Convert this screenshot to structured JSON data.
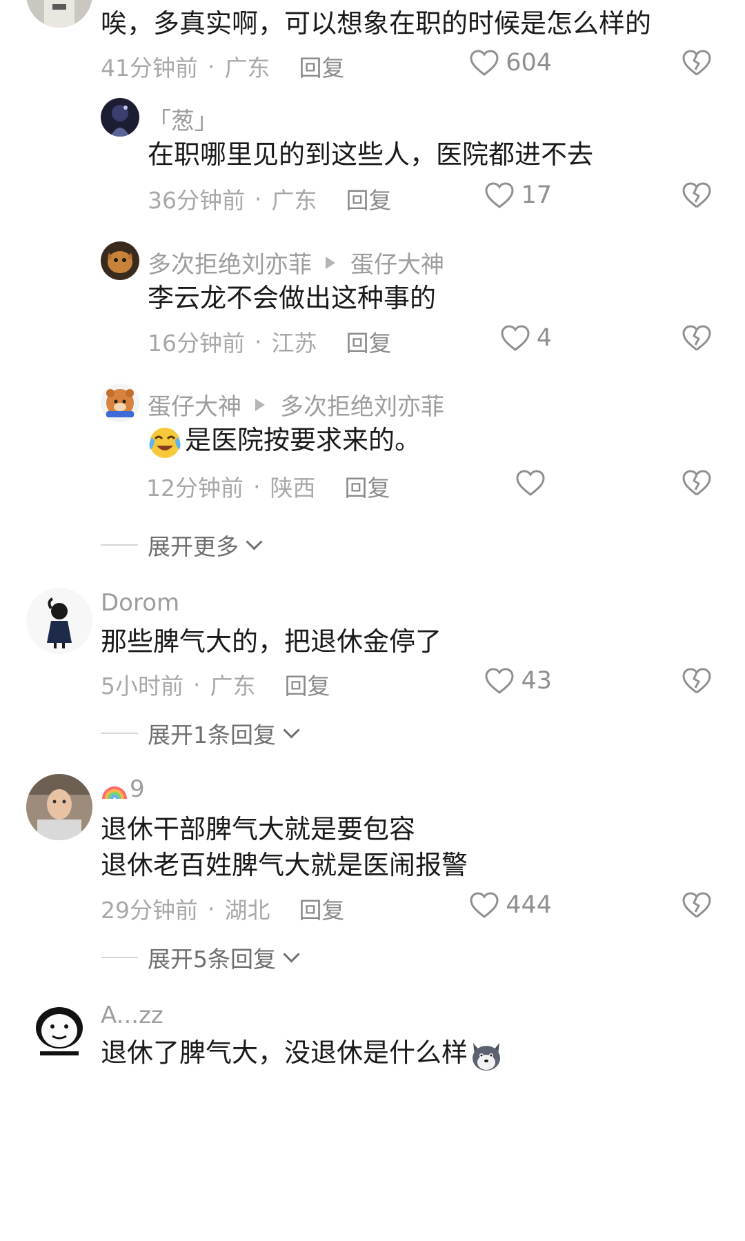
{
  "comments": [
    {
      "id": "c1",
      "text": "唉，多真实啊，可以想象在职的时候是怎么样的",
      "time": "41分钟前",
      "location": "广东",
      "reply_label": "回复",
      "likes": "604"
    },
    {
      "id": "c2",
      "username": "「葱」",
      "text": "在职哪里见的到这些人，医院都进不去",
      "time": "36分钟前",
      "location": "广东",
      "reply_label": "回复",
      "likes": "17"
    },
    {
      "id": "c3",
      "username": "多次拒绝刘亦菲",
      "reply_to": "蛋仔大神",
      "text": "李云龙不会做出这种事的",
      "time": "16分钟前",
      "location": "江苏",
      "reply_label": "回复",
      "likes": "4"
    },
    {
      "id": "c4",
      "username": "蛋仔大神",
      "reply_to": "多次拒绝刘亦菲",
      "emoji": "crying-laughing-emoji",
      "text": "是医院按要求来的。",
      "time": "12分钟前",
      "location": "陕西",
      "reply_label": "回复",
      "likes": ""
    },
    {
      "id": "c5",
      "username": "Dorom",
      "text": "那些脾气大的，把退休金停了",
      "time": "5小时前",
      "location": "广东",
      "reply_label": "回复",
      "likes": "43"
    },
    {
      "id": "c6",
      "username": "9",
      "username_icon": "rainbow-icon",
      "text_line1": "退休干部脾气大就是要包容",
      "text_line2": "退休老百姓脾气大就是医闹报警",
      "time": "29分钟前",
      "location": "湖北",
      "reply_label": "回复",
      "likes": "444"
    },
    {
      "id": "c7",
      "username": "A...zz",
      "text": "退休了脾气大，没退休是什么样",
      "emoji": "husky-emoji"
    }
  ],
  "expand": {
    "more": "展开更多",
    "one_reply": "展开1条回复",
    "five_replies": "展开5条回复"
  },
  "meta_separator": "·",
  "colors": {
    "text": "#1a1a1a",
    "meta": "#a8a8a8",
    "icon": "#8f8f8f"
  }
}
